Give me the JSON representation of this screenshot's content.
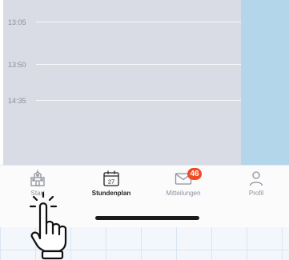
{
  "calendar": {
    "times": [
      {
        "label": "13:05"
      },
      {
        "label": "13:50"
      },
      {
        "label": "14:35"
      }
    ]
  },
  "tabs": [
    {
      "label": "Start",
      "icon": "school-icon",
      "active": false
    },
    {
      "label": "Stundenplan",
      "icon": "calendar-icon",
      "active": true,
      "icon_text": "27"
    },
    {
      "label": "Mitteilungen",
      "icon": "mail-icon",
      "active": false,
      "badge": "46"
    },
    {
      "label": "Profil",
      "icon": "person-icon",
      "active": false
    }
  ],
  "overlay": {
    "icon": "pointing-hand-icon"
  },
  "colors": {
    "calendar_bg": "#d9dce5",
    "right_strip": "#b4d6ea",
    "badge": "#f04a22",
    "active_label": "#222222",
    "inactive": "#8c919b"
  }
}
